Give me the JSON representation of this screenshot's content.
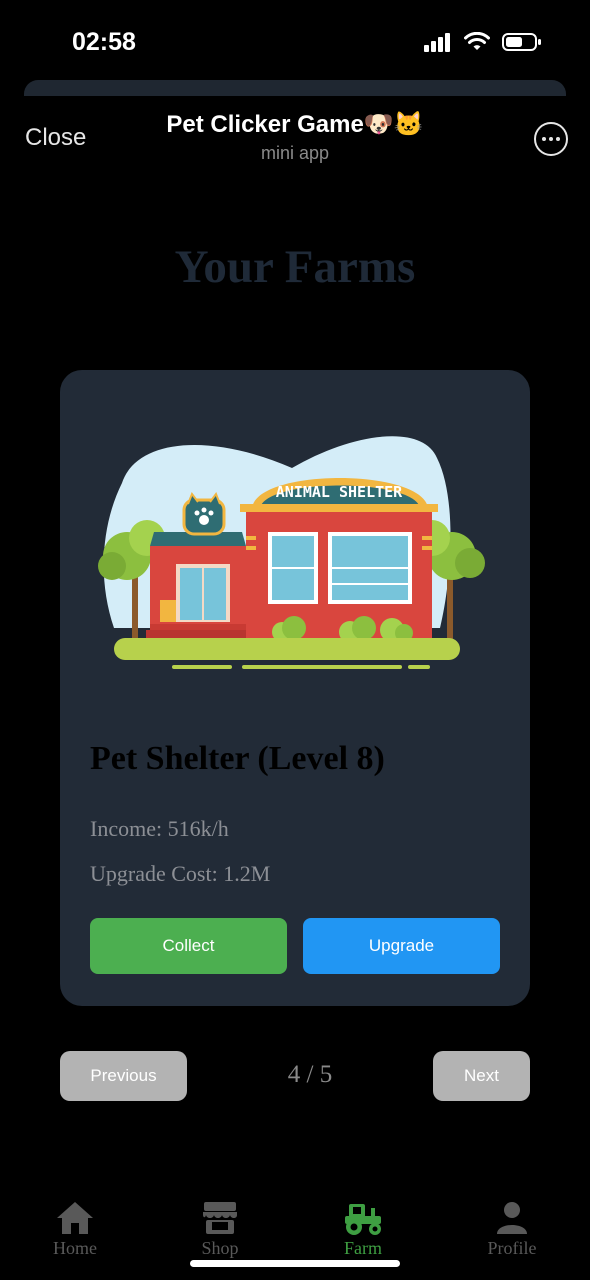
{
  "status_bar": {
    "time": "02:58"
  },
  "header": {
    "close_label": "Close",
    "title": "Pet Clicker Game🐶🐱",
    "subtitle": "mini app",
    "more_icon": "ellipsis-circle-icon"
  },
  "page": {
    "heading": "Your Farms"
  },
  "farm": {
    "image_sign_text": "ANIMAL SHELTER",
    "name": "Pet Shelter (Level 8)",
    "income": "Income: 516k/h",
    "upgrade_cost": "Upgrade Cost: 1.2M",
    "collect_label": "Collect",
    "upgrade_label": "Upgrade"
  },
  "pagination": {
    "previous_label": "Previous",
    "indicator": "4 / 5",
    "next_label": "Next"
  },
  "tabbar": {
    "items": [
      {
        "label": "Home",
        "icon": "home-icon",
        "active": false
      },
      {
        "label": "Shop",
        "icon": "shop-icon",
        "active": false
      },
      {
        "label": "Farm",
        "icon": "tractor-icon",
        "active": true
      },
      {
        "label": "Profile",
        "icon": "person-icon",
        "active": false
      }
    ]
  },
  "colors": {
    "background": "#000000",
    "card": "#222b37",
    "collect": "#4caf50",
    "upgrade": "#2196f3",
    "active_tab": "#3e9e42",
    "pager_button": "#b3b3b3"
  }
}
